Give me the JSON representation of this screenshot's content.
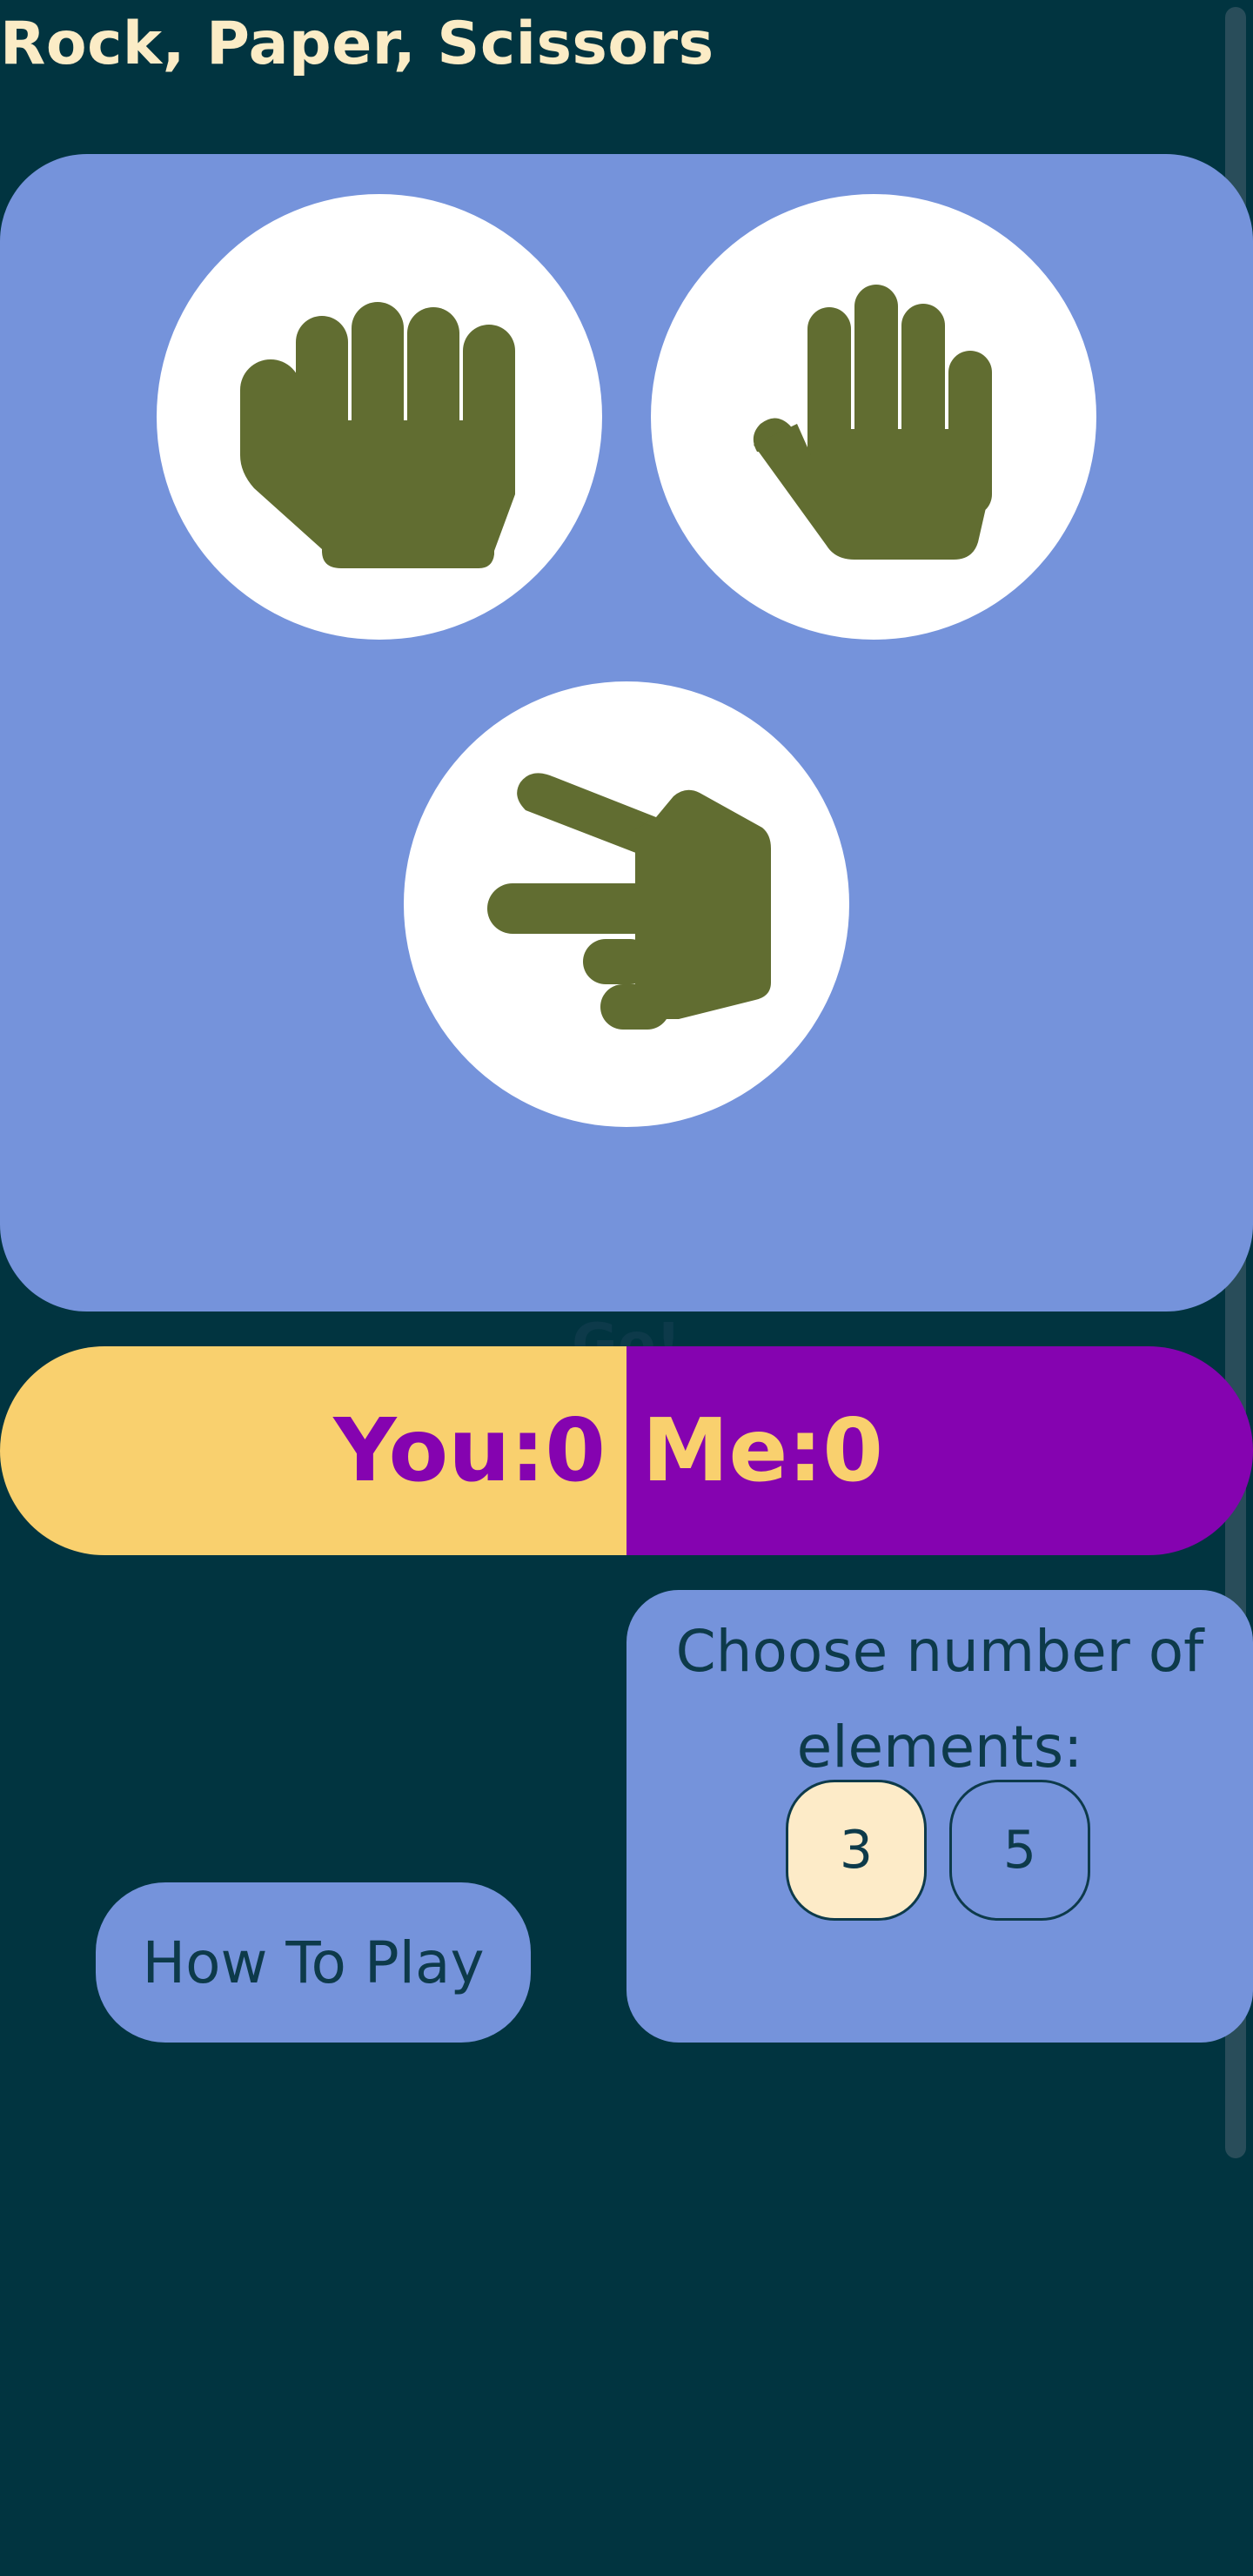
{
  "header": {
    "title": "Rock, Paper, Scissors"
  },
  "game": {
    "choices": [
      {
        "id": "rock",
        "icon": "rock-fist-icon"
      },
      {
        "id": "paper",
        "icon": "paper-open-hand-icon"
      },
      {
        "id": "scissors",
        "icon": "scissors-hand-icon"
      }
    ],
    "go_label": "Go!"
  },
  "score": {
    "you_label": "You:",
    "you_value": "0",
    "me_label": "Me:",
    "me_value": "0"
  },
  "elements": {
    "label": "Choose number of elements:",
    "options": [
      "3",
      "5"
    ],
    "selected": "3"
  },
  "how_to_play": {
    "label": "How To Play"
  },
  "colors": {
    "background": "#013440",
    "panel": "#7593db",
    "hand": "#616d31",
    "title": "#fbecc6",
    "you_bg": "#f9d06e",
    "me_bg": "#8503b0",
    "selected_option": "#fdebc8"
  }
}
